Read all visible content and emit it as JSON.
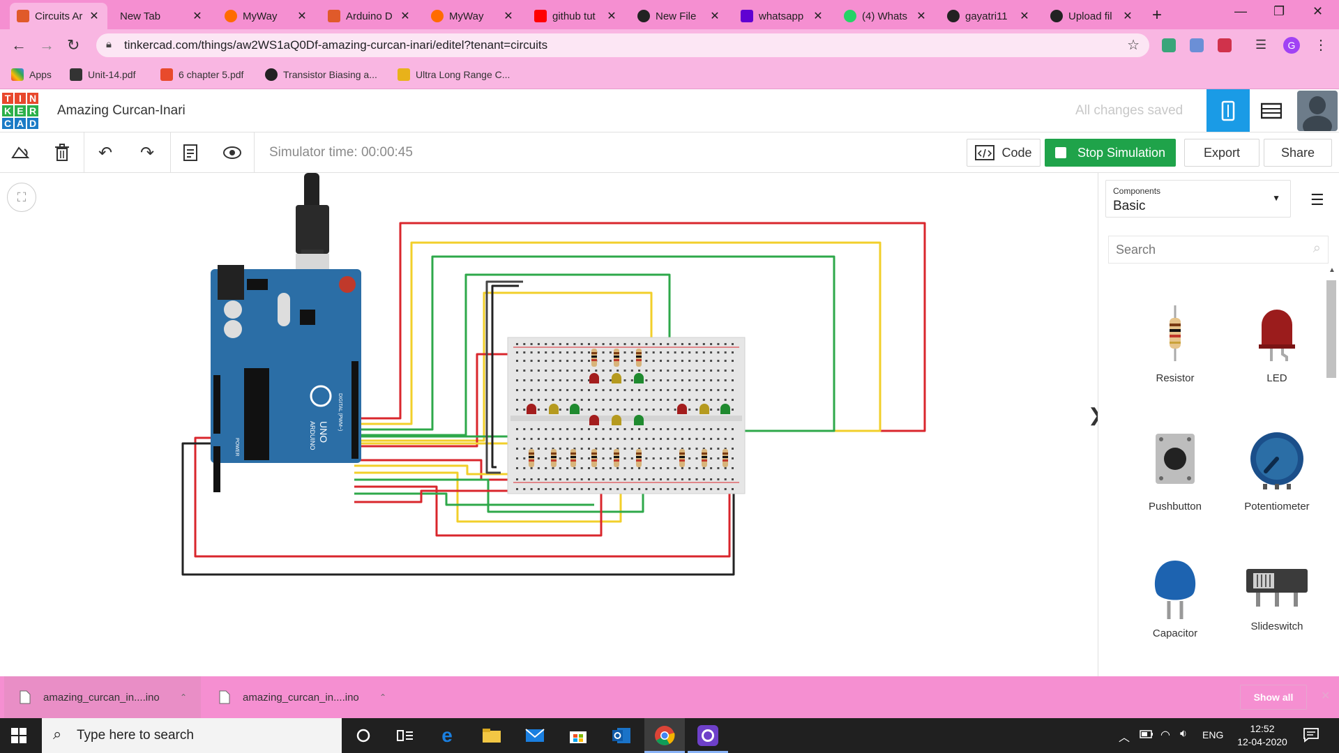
{
  "browser": {
    "tabs": [
      {
        "title": "Circuits Ar",
        "active": true
      },
      {
        "title": "New Tab"
      },
      {
        "title": "MyWay"
      },
      {
        "title": "Arduino D"
      },
      {
        "title": "MyWay"
      },
      {
        "title": "github tut"
      },
      {
        "title": "New File"
      },
      {
        "title": "whatsapp"
      },
      {
        "title": "(4) Whats"
      },
      {
        "title": "gayatri11"
      },
      {
        "title": "Upload fil"
      }
    ],
    "url": "tinkercad.com/things/aw2WS1aQ0Df-amazing-curcan-inari/editel?tenant=circuits",
    "profile_initial": "G",
    "bookmarks": [
      "Apps",
      "Unit-14.pdf",
      "6 chapter 5.pdf",
      "Transistor Biasing a...",
      "Ultra Long Range C..."
    ]
  },
  "app": {
    "logo_letters": [
      "T",
      "I",
      "N",
      "K",
      "E",
      "R",
      "C",
      "A",
      "D"
    ],
    "title": "Amazing Curcan-Inari",
    "save_status": "All changes saved",
    "simulator_time": "Simulator time: 00:00:45",
    "code_label": "Code",
    "stop_label": "Stop Simulation",
    "export_label": "Export",
    "share_label": "Share"
  },
  "panel": {
    "components_label": "Components",
    "category": "Basic",
    "search_placeholder": "Search",
    "items": [
      "Resistor",
      "LED",
      "Pushbutton",
      "Potentiometer",
      "Capacitor",
      "Slideswitch"
    ]
  },
  "downloads": {
    "files": [
      "amazing_curcan_in....ino",
      "amazing_curcan_in....ino"
    ],
    "show_all": "Show all"
  },
  "taskbar": {
    "search_placeholder": "Type here to search",
    "language": "ENG",
    "time": "12:52",
    "date": "12-04-2020"
  },
  "board_labels": {
    "arduino": "ARDUINO",
    "uno": "UNO",
    "aref": "AREF",
    "gnd": "GND",
    "digital": "DIGITAL (PWM~)",
    "analog": "ANALOG IN",
    "power": "POWER"
  },
  "colors": {
    "red_wire": "#d9262c",
    "yellow_wire": "#f2cf2a",
    "green_wire": "#2ea84a",
    "black_wire": "#222222",
    "arduino_blue": "#2b6ea6",
    "stop_green": "#1fa34a",
    "accent_blue": "#1a9be6"
  }
}
